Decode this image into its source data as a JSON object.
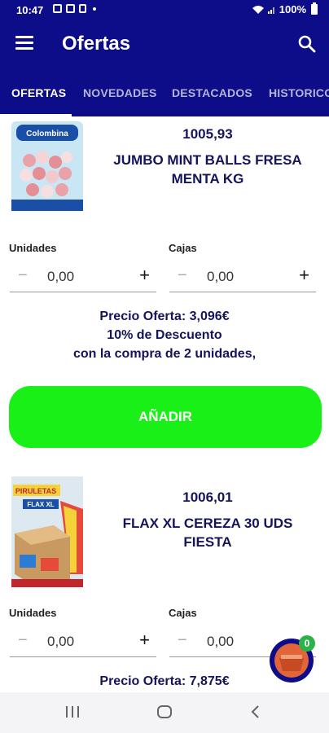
{
  "status_bar": {
    "time": "10:47",
    "battery": "100%"
  },
  "app_bar": {
    "title": "Ofertas",
    "menu_icon": "hamburger-menu-icon",
    "search_icon": "search-icon"
  },
  "tabs": [
    {
      "label": "OFERTAS",
      "active": true
    },
    {
      "label": "NOVEDADES",
      "active": false
    },
    {
      "label": "DESTACADOS",
      "active": false
    },
    {
      "label": "HISTORICO",
      "active": false
    }
  ],
  "products": [
    {
      "code": "1005,93",
      "name_line1": "JUMBO MINT BALLS FRESA",
      "name_line2": "MENTA KG",
      "units_label": "Unidades",
      "units_value": "0,00",
      "boxes_label": "Cajas",
      "boxes_value": "0,00",
      "offer_price": "Precio Oferta: 3,096€",
      "offer_discount": "10% de Descuento",
      "offer_condition": "con la compra de 2 unidades,",
      "add_label": "AÑADIR",
      "image_text_top": "Colombina",
      "image_color": "#c9e6f5"
    },
    {
      "code": "1006,01",
      "name_line1": "FLAX XL CEREZA 30 UDS",
      "name_line2": "FIESTA",
      "units_label": "Unidades",
      "units_value": "0,00",
      "boxes_label": "Cajas",
      "boxes_value": "0,00",
      "offer_price": "Precio Oferta: 7,875€",
      "image_text_top": "PIRULETAS",
      "image_text_brand": "FLAX XL",
      "image_color": "#f6d23a"
    }
  ],
  "cart": {
    "count": "0"
  },
  "colors": {
    "primary": "#0d0d8a",
    "accent_green": "#18f018",
    "text_dark": "#14145a"
  }
}
